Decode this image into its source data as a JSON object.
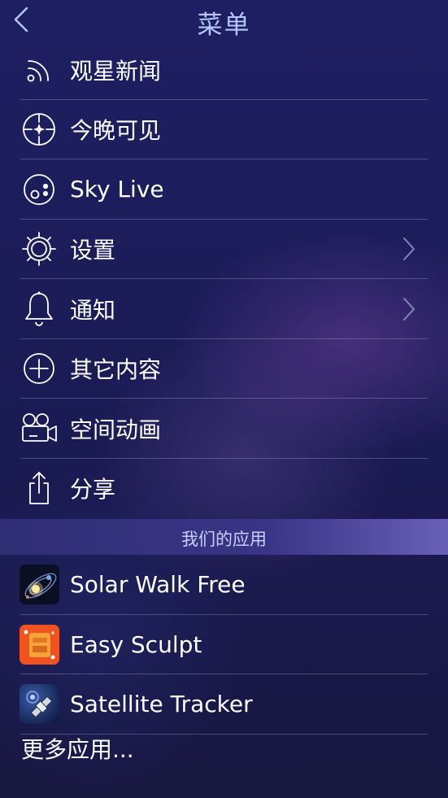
{
  "header": {
    "title": "菜单",
    "back_icon": "chevron-left-icon"
  },
  "menu": {
    "items": [
      {
        "label": "观星新闻",
        "icon": "rss-icon"
      },
      {
        "label": "今晚可见",
        "icon": "compass-star-icon"
      },
      {
        "label": "Sky Live",
        "icon": "moon-phase-icon"
      },
      {
        "label": "设置",
        "icon": "gear-icon",
        "has_chevron": true
      },
      {
        "label": "通知",
        "icon": "bell-icon",
        "has_chevron": true
      },
      {
        "label": "其它内容",
        "icon": "plus-circle-icon"
      },
      {
        "label": "空间动画",
        "icon": "video-camera-icon"
      },
      {
        "label": "分享",
        "icon": "share-icon"
      }
    ]
  },
  "apps_section": {
    "title": "我们的应用",
    "apps": [
      {
        "label": "Solar Walk Free",
        "icon": "solar-walk-app-icon"
      },
      {
        "label": "Easy Sculpt",
        "icon": "easy-sculpt-app-icon"
      },
      {
        "label": "Satellite Tracker",
        "icon": "satellite-tracker-app-icon"
      }
    ],
    "more_label": "更多应用..."
  },
  "colors": {
    "title": "#b7c7ff",
    "section_title": "#c7d1ff",
    "background": "#1b1c57",
    "divider": "#c8cdf0"
  }
}
